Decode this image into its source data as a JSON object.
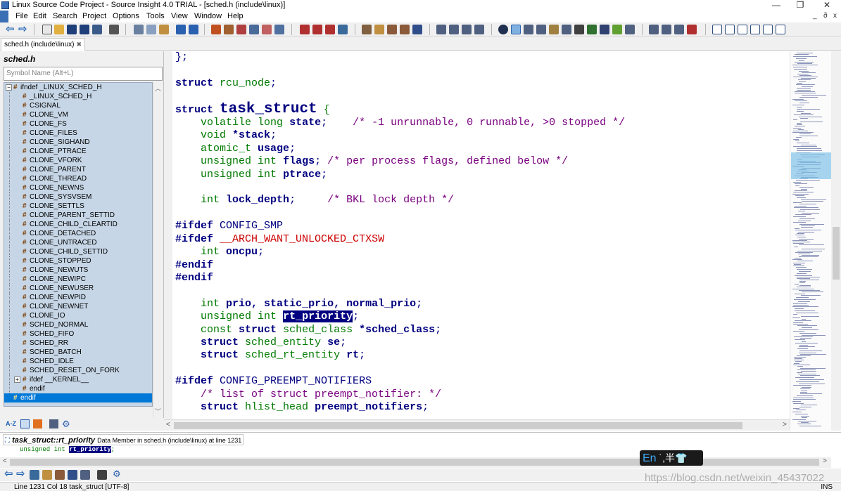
{
  "window": {
    "title": "Linux Source Code Project - Source Insight 4.0 TRIAL - [sched.h (include\\linux)]",
    "minimize": "—",
    "maximize": "❐",
    "close": "✕"
  },
  "menu": {
    "items": [
      "File",
      "Edit",
      "Search",
      "Project",
      "Options",
      "Tools",
      "View",
      "Window",
      "Help"
    ],
    "mdi_controls": [
      "_",
      "ð",
      "x"
    ]
  },
  "tabs": [
    {
      "label": "sched.h (include\\linux)",
      "close": "✖"
    }
  ],
  "symbol_window": {
    "file_title": "sched.h",
    "search_placeholder": "Symbol Name (Alt+L)",
    "items": [
      {
        "label": "ifndef _LINUX_SCHED_H",
        "level": 0,
        "expander": "⊟"
      },
      {
        "label": "_LINUX_SCHED_H",
        "level": 1
      },
      {
        "label": "CSIGNAL",
        "level": 1
      },
      {
        "label": "CLONE_VM",
        "level": 1
      },
      {
        "label": "CLONE_FS",
        "level": 1
      },
      {
        "label": "CLONE_FILES",
        "level": 1
      },
      {
        "label": "CLONE_SIGHAND",
        "level": 1
      },
      {
        "label": "CLONE_PTRACE",
        "level": 1
      },
      {
        "label": "CLONE_VFORK",
        "level": 1
      },
      {
        "label": "CLONE_PARENT",
        "level": 1
      },
      {
        "label": "CLONE_THREAD",
        "level": 1
      },
      {
        "label": "CLONE_NEWNS",
        "level": 1
      },
      {
        "label": "CLONE_SYSVSEM",
        "level": 1
      },
      {
        "label": "CLONE_SETTLS",
        "level": 1
      },
      {
        "label": "CLONE_PARENT_SETTID",
        "level": 1
      },
      {
        "label": "CLONE_CHILD_CLEARTID",
        "level": 1
      },
      {
        "label": "CLONE_DETACHED",
        "level": 1
      },
      {
        "label": "CLONE_UNTRACED",
        "level": 1
      },
      {
        "label": "CLONE_CHILD_SETTID",
        "level": 1
      },
      {
        "label": "CLONE_STOPPED",
        "level": 1
      },
      {
        "label": "CLONE_NEWUTS",
        "level": 1
      },
      {
        "label": "CLONE_NEWIPC",
        "level": 1
      },
      {
        "label": "CLONE_NEWUSER",
        "level": 1
      },
      {
        "label": "CLONE_NEWPID",
        "level": 1
      },
      {
        "label": "CLONE_NEWNET",
        "level": 1
      },
      {
        "label": "CLONE_IO",
        "level": 1
      },
      {
        "label": "SCHED_NORMAL",
        "level": 1
      },
      {
        "label": "SCHED_FIFO",
        "level": 1
      },
      {
        "label": "SCHED_RR",
        "level": 1
      },
      {
        "label": "SCHED_BATCH",
        "level": 1
      },
      {
        "label": "SCHED_IDLE",
        "level": 1
      },
      {
        "label": "SCHED_RESET_ON_FORK",
        "level": 1
      },
      {
        "label": "ifdef __KERNEL__",
        "level": 1,
        "expander": "⊞"
      },
      {
        "label": "endif",
        "level": 1
      },
      {
        "label": "endif",
        "level": 0,
        "selected": true
      }
    ],
    "bottom_icons": [
      "az-sort-icon",
      "list-view-icon",
      "category-icon",
      "columns-icon",
      "settings-icon"
    ]
  },
  "editor": {
    "code": {
      "l01": "};",
      "l03_kw": "struct",
      "l03_ty": "rcu_node",
      "l05_kw": "struct",
      "l05_name": "task_struct",
      "l05_brace": "{",
      "l06_ty": "volatile long",
      "l06_id": "state",
      "l06_cm": "/* -1 unrunnable, 0 runnable, >0 stopped */",
      "l07_ty": "void",
      "l07_id": "*stack",
      "l08_ty": "atomic_t",
      "l08_id": "usage",
      "l09_ty": "unsigned int",
      "l09_id": "flags",
      "l09_cm": "/* per process flags, defined below */",
      "l10_ty": "unsigned int",
      "l10_id": "ptrace",
      "l12_ty": "int",
      "l12_id": "lock_depth",
      "l12_cm": "/* BKL lock depth */",
      "l14_pp": "#ifdef",
      "l14_name": "CONFIG_SMP",
      "l15_pp": "#ifdef",
      "l15_name": "__ARCH_WANT_UNLOCKED_CTXSW",
      "l16_ty": "int",
      "l16_id": "oncpu",
      "l17_pp": "#endif",
      "l18_pp": "#endif",
      "l20_ty": "int",
      "l20_id": "prio, static_prio, normal_prio",
      "l21_ty": "unsigned int",
      "l21_sel": "rt_priority",
      "l22_ty1": "const",
      "l22_kw": "struct",
      "l22_ty2": "sched_class",
      "l22_id": "*sched_class",
      "l23_kw": "struct",
      "l23_ty": "sched_entity",
      "l23_id": "se",
      "l24_kw": "struct",
      "l24_ty": "sched_rt_entity",
      "l24_id": "rt",
      "l26_pp": "#ifdef",
      "l26_name": "CONFIG_PREEMPT_NOTIFIERS",
      "l27_cm": "/* list of struct preempt_notifier: */",
      "l28_kw": "struct",
      "l28_ty": "hlist_head",
      "l28_id": "preempt_notifiers"
    }
  },
  "context_window": {
    "symbol": "task_struct::rt_priority",
    "description": "Data Member in sched.h (include\\linux) at line 1231",
    "code_prefix": "unsigned int ",
    "code_selected": "rt_priority",
    "code_suffix": ";"
  },
  "status_bar": {
    "left": "Line 1231  Col 18   task_struct [UTF-8]",
    "right": "INS"
  },
  "ime": {
    "lang": "En",
    "symbols": "˙,半👕"
  },
  "watermark": "https://blog.csdn.net/weixin_45437022",
  "colors": {
    "keyword": "#000080",
    "type": "#007a00",
    "comment": "#7a0080",
    "macro_red": "#cc0000",
    "selection_bg": "#000080",
    "tree_bg": "#c6d6e6",
    "tree_selected": "#0078d7"
  }
}
